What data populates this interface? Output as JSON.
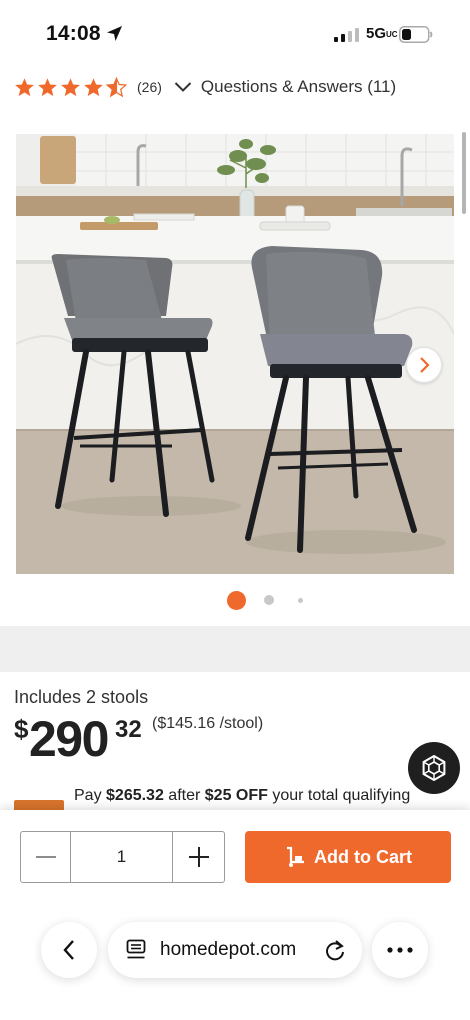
{
  "status_bar": {
    "time": "14:08",
    "network": "5G",
    "network_suffix": "UC"
  },
  "rating": {
    "stars": 4.5,
    "review_count": "(26)",
    "qa_label": "Questions & Answers (11)"
  },
  "gallery": {
    "image_count": 3,
    "active_index": 0
  },
  "product": {
    "includes": "Includes 2 stools",
    "price_symbol": "$",
    "price_whole": "290",
    "price_cents": "32",
    "unit_price": "($145.16 /stool)"
  },
  "promo": {
    "prefix": "Pay ",
    "amount": "$265.32",
    "middle": " after ",
    "discount": "$25 OFF",
    "suffix": " your total qualifying"
  },
  "cart": {
    "quantity": "1",
    "add_label": "Add to Cart"
  },
  "browser": {
    "url": "homedepot.com"
  },
  "colors": {
    "brand_orange": "#f0692c",
    "star_orange": "#f0692c",
    "dot_active": "#f0692c",
    "dot_inactive": "#c8c8c8"
  }
}
